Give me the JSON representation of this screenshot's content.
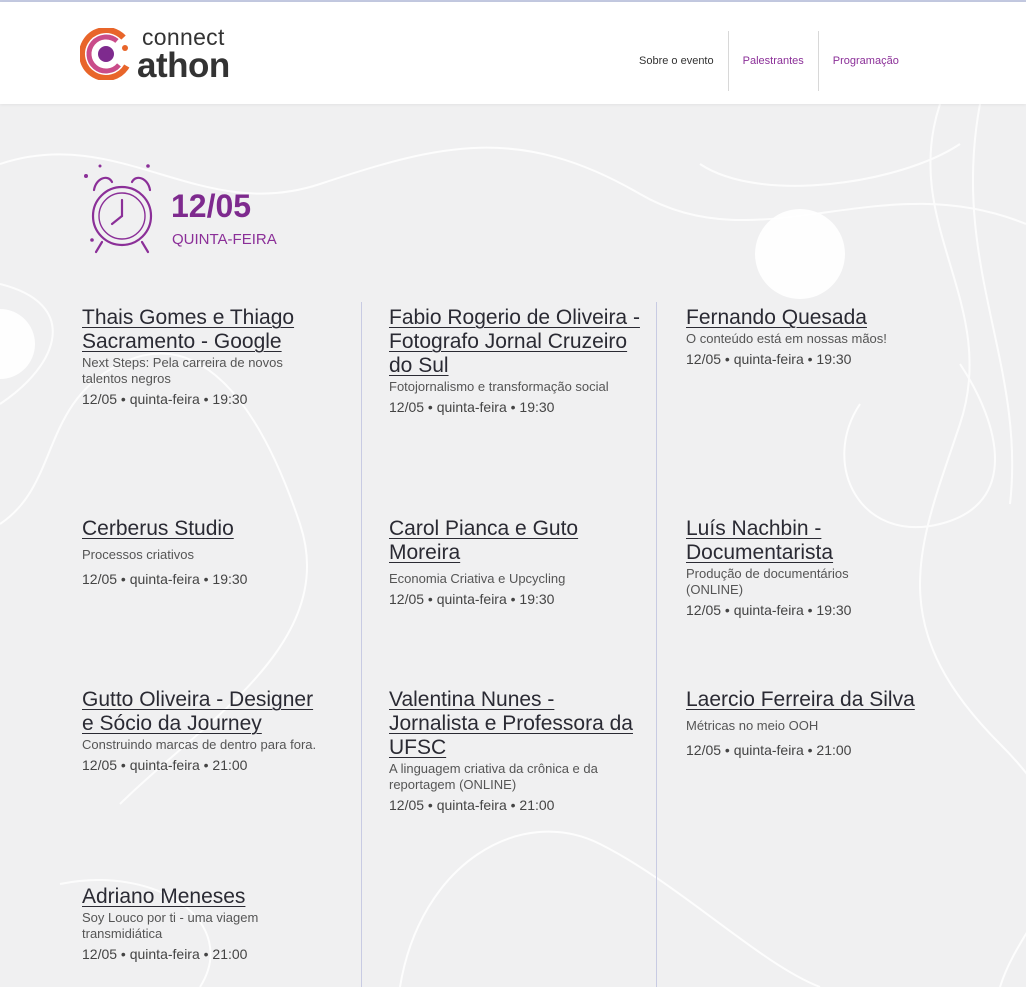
{
  "logo": {
    "line1": "connect",
    "line2": "athon"
  },
  "nav": [
    {
      "label": "Sobre o evento"
    },
    {
      "label": "Palestrantes"
    },
    {
      "label": "Programação"
    }
  ],
  "date": {
    "number": "12/05",
    "weekday": "QUINTA-FEIRA"
  },
  "colors": {
    "accent": "#7e2a8e",
    "accent_light": "#8b2f98",
    "logo_orange": "#e8652a",
    "background": "#f0f0f1"
  },
  "sessions": [
    {
      "title": "Thais Gomes e Thiago Sacramento - Google",
      "desc": "Next Steps: Pela carreira de novos talentos negros",
      "meta": "12/05 • quinta-feira • 19:30"
    },
    {
      "title": "Fabio Rogerio de Oliveira - Fotografo Jornal Cruzeiro do Sul",
      "desc": "Fotojornalismo e transformação social",
      "meta": "12/05 • quinta-feira • 19:30"
    },
    {
      "title": "Fernando Quesada",
      "desc": "O conteúdo está em nossas mãos!",
      "meta": "12/05 • quinta-feira • 19:30"
    },
    {
      "title": "Cerberus Studio",
      "desc": "Processos criativos",
      "meta": "12/05 • quinta-feira • 19:30"
    },
    {
      "title": "Carol Pianca e Guto Moreira",
      "desc": "Economia Criativa e Upcycling",
      "meta": "12/05 • quinta-feira • 19:30"
    },
    {
      "title": "Luís Nachbin - Documentarista",
      "desc": "Produção de documentários (ONLINE)",
      "meta": "12/05 • quinta-feira • 19:30"
    },
    {
      "title": "Gutto Oliveira - Designer e Sócio da Journey",
      "desc": "Construindo marcas de dentro para fora.",
      "meta": "12/05 • quinta-feira • 21:00"
    },
    {
      "title": "Valentina Nunes - Jornalista e Professora da UFSC",
      "desc": "A linguagem criativa da crônica e da reportagem (ONLINE)",
      "meta": "12/05 • quinta-feira • 21:00"
    },
    {
      "title": "Laercio Ferreira da Silva",
      "desc": "Métricas no meio OOH",
      "meta": "12/05 • quinta-feira • 21:00"
    },
    {
      "title": "Adriano Meneses",
      "desc": "Soy Louco por ti - uma viagem transmidiática",
      "meta": "12/05 • quinta-feira • 21:00"
    }
  ]
}
